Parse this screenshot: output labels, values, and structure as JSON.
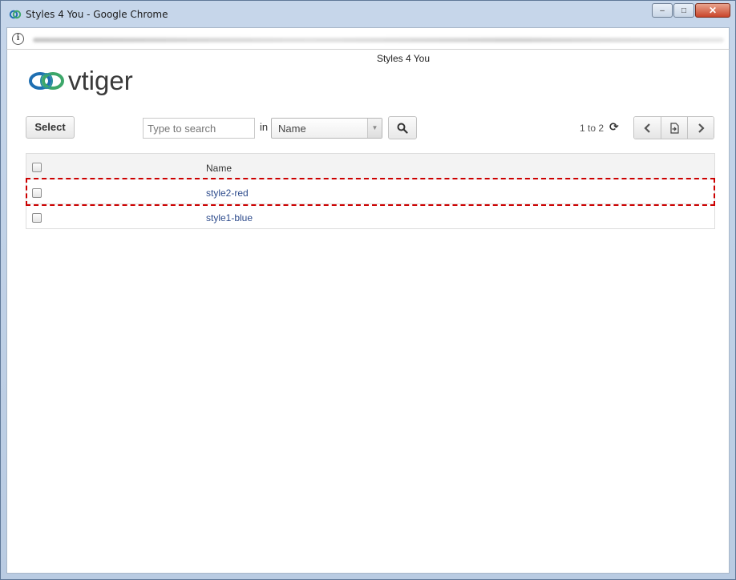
{
  "window": {
    "title": "Styles 4 You - Google Chrome",
    "controls": {
      "minimize": "–",
      "maximize": "□",
      "close": "✕"
    }
  },
  "address_bar": {
    "info_icon": "i"
  },
  "page": {
    "title": "Styles 4 You",
    "logo_text": "vtiger"
  },
  "toolbar": {
    "select_label": "Select",
    "search_placeholder": "Type to search",
    "in_label": "in",
    "field_selected": "Name",
    "paging_text": "1 to 2",
    "refresh_icon": "⟳"
  },
  "table": {
    "columns": [
      "Name"
    ],
    "rows": [
      {
        "name": "style2-red",
        "highlighted": true
      },
      {
        "name": "style1-blue",
        "highlighted": false
      }
    ]
  },
  "colors": {
    "link": "#2d4b8c",
    "highlight_border": "#cc0000",
    "logo_blue": "#1f6fb2",
    "logo_green": "#3da76a"
  }
}
